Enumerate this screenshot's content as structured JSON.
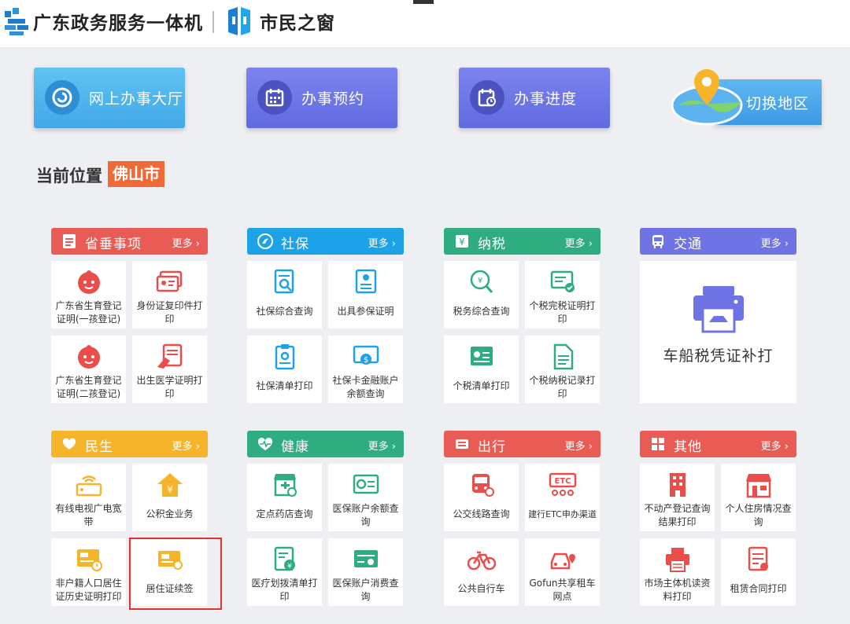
{
  "header": {
    "title_main": "广东政务服务一体机",
    "title_sub": "市民之窗"
  },
  "actions": {
    "online_hall": "网上办事大厅",
    "appointment": "办事预约",
    "progress": "办事进度",
    "switch_region": "切换地区"
  },
  "location": {
    "label": "当前位置",
    "city": "佛山市"
  },
  "more_label": "更多 ›",
  "sections": {
    "province": {
      "title": "省垂事项",
      "items": [
        {
          "label": "广东省生育登记证明(一孩登记)",
          "icon": "baby-icon"
        },
        {
          "label": "身份证复印件打印",
          "icon": "id-card-icon"
        },
        {
          "label": "广东省生育登记证明(二孩登记)",
          "icon": "baby-icon"
        },
        {
          "label": "出生医学证明打印",
          "icon": "birth-certificate-icon"
        }
      ]
    },
    "social": {
      "title": "社保",
      "items": [
        {
          "label": "社保综合查询",
          "icon": "social-query-icon"
        },
        {
          "label": "出具参保证明",
          "icon": "insurance-proof-icon"
        },
        {
          "label": "社保清单打印",
          "icon": "clipboard-icon"
        },
        {
          "label": "社保卡金融账户余额查询",
          "icon": "card-balance-icon"
        }
      ]
    },
    "tax": {
      "title": "纳税",
      "items": [
        {
          "label": "税务综合查询",
          "icon": "tax-search-icon"
        },
        {
          "label": "个税完税证明打印",
          "icon": "tax-certificate-icon"
        },
        {
          "label": "个税清单打印",
          "icon": "tax-list-icon"
        },
        {
          "label": "个税纳税记录打印",
          "icon": "tax-record-icon"
        }
      ]
    },
    "traffic": {
      "title": "交通",
      "big_item": {
        "label": "车船税凭证补打",
        "icon": "printer-icon"
      }
    },
    "livelihood": {
      "title": "民生",
      "items": [
        {
          "label": "有线电视广电宽带",
          "icon": "router-icon"
        },
        {
          "label": "公积金业务",
          "icon": "housing-fund-icon"
        },
        {
          "label": "非户籍人口居住证历史证明打印",
          "icon": "residence-history-icon"
        },
        {
          "label": "居住证续签",
          "icon": "residence-card-icon"
        }
      ]
    },
    "health": {
      "title": "健康",
      "items": [
        {
          "label": "定点药店查询",
          "icon": "pharmacy-icon"
        },
        {
          "label": "医保账户余额查询",
          "icon": "medical-balance-icon"
        },
        {
          "label": "医疗划拨清单打印",
          "icon": "medical-list-icon"
        },
        {
          "label": "医保账户消费查询",
          "icon": "medical-consume-icon"
        }
      ]
    },
    "travel": {
      "title": "出行",
      "items": [
        {
          "label": "公交线路查询",
          "icon": "bus-icon"
        },
        {
          "label": "建行ETC申办渠道",
          "icon": "etc-icon",
          "icon_text": "ETC"
        },
        {
          "label": "公共自行车",
          "icon": "bicycle-icon"
        },
        {
          "label": "Gofun共享租车网点",
          "icon": "car-location-icon"
        }
      ]
    },
    "other": {
      "title": "其他",
      "items": [
        {
          "label": "不动产登记查询结果打印",
          "icon": "building-icon"
        },
        {
          "label": "个人住房情况查询",
          "icon": "shop-icon"
        },
        {
          "label": "市场主体机读资料打印",
          "icon": "print-doc-icon"
        },
        {
          "label": "租赁合同打印",
          "icon": "contract-icon"
        }
      ]
    }
  },
  "colors": {
    "red": "#e95c55",
    "blue": "#1ea2e7",
    "green": "#2fad81",
    "purple": "#6f73e3",
    "yellow": "#f6b42a",
    "highlight": "#e3322e"
  }
}
